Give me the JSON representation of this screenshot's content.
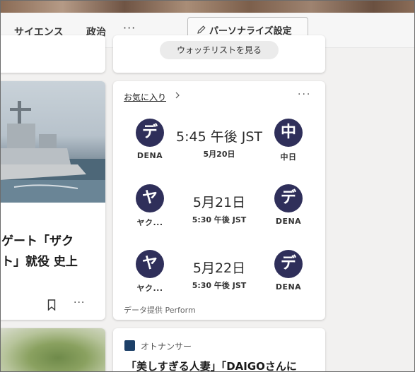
{
  "nav": {
    "items": [
      "サイエンス",
      "政治"
    ],
    "more_label": "···",
    "personalize_label": "パーソナライズ設定"
  },
  "watchlist": {
    "button_label": "ウォッチリストを見る"
  },
  "article": {
    "title_line1": "ゲート「ザク",
    "title_line2": "ト」就役 史上",
    "more_label": "···"
  },
  "favorites": {
    "header": "お気に入り",
    "more_label": "···",
    "matches": [
      {
        "home": {
          "logo": "デ",
          "abbr": "DENA"
        },
        "main": "5:45 午後 JST",
        "sub": "5月20日",
        "away": {
          "logo": "中",
          "abbr": "中日"
        }
      },
      {
        "home": {
          "logo": "ヤ",
          "abbr": "ヤク..."
        },
        "main": "5月21日",
        "sub": "5:30 午後 JST",
        "away": {
          "logo": "デ",
          "abbr": "DENA"
        }
      },
      {
        "home": {
          "logo": "ヤ",
          "abbr": "ヤク..."
        },
        "main": "5月22日",
        "sub": "5:30 午後 JST",
        "away": {
          "logo": "デ",
          "abbr": "DENA"
        }
      }
    ],
    "provider": "データ提供 Perform"
  },
  "news": {
    "source": "オトナンサー",
    "title": "「美しすぎる人妻」「DAIGOさんに"
  },
  "colors": {
    "team_logo_bg": "#2f2f5a",
    "page_bg": "#f2f1f0",
    "card_bg": "#ffffff"
  }
}
